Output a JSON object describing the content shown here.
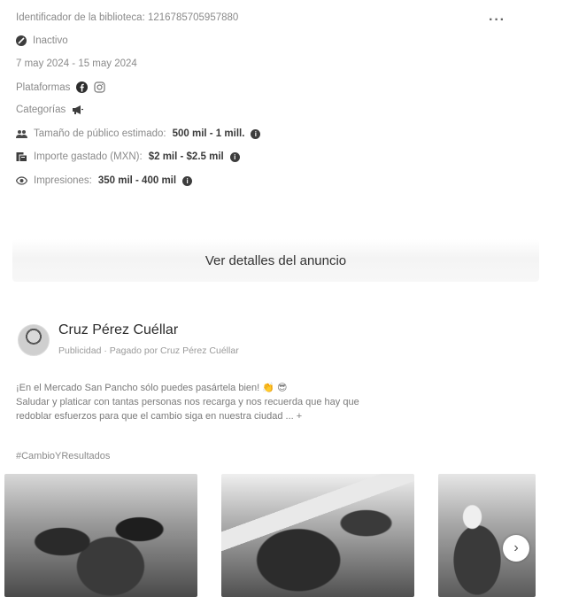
{
  "library": {
    "id_label": "Identificador de la biblioteca:",
    "id_value": "1216785705957880"
  },
  "status": {
    "label": "Inactivo",
    "icon": "inactive-circle-icon"
  },
  "dates": "7 may 2024 - 15 may 2024",
  "platforms": {
    "label": "Plataformas",
    "icons": [
      "facebook-icon",
      "instagram-icon"
    ]
  },
  "categories": {
    "label": "Categorías",
    "icon": "megaphone-icon"
  },
  "metrics": [
    {
      "icon": "audience-icon",
      "label": "Tamaño de público estimado:",
      "value": "500 mil - 1 mill."
    },
    {
      "icon": "money-icon",
      "label": "Importe gastado (MXN):",
      "value": "$2 mil - $2.5 mil"
    },
    {
      "icon": "eye-icon",
      "label": "Impresiones:",
      "value": "350 mil - 400 mil"
    }
  ],
  "more_label": "···",
  "details_button": "Ver detalles del anuncio",
  "ad": {
    "advertiser": "Cruz Pérez Cuéllar",
    "subtitle": "Publicidad · Pagado por Cruz Pérez Cuéllar",
    "text_line1": "¡En el Mercado San Pancho sólo puedes pasártela bien! 👏 😎",
    "text_line2": "Saludar y platicar con tantas personas nos recarga y nos recuerda que hay que",
    "text_line3": "redoblar esfuerzos para que el cambio siga en nuestra ciudad ... +",
    "hashtag": "#CambioYResultados",
    "carousel_next": "›"
  }
}
